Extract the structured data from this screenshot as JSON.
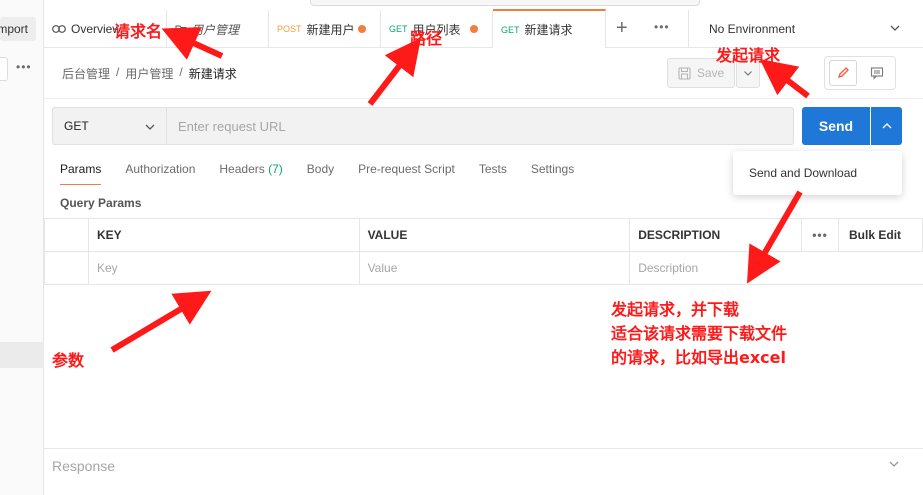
{
  "sidebar": {
    "import_label": "Import",
    "more_icon": "more-dots-icon"
  },
  "tabs": {
    "items": [
      {
        "method": "",
        "label": "Overview",
        "unsaved": false
      },
      {
        "method": "",
        "label": "用户管理",
        "unsaved": false
      },
      {
        "method": "POST",
        "label": "新建用户",
        "unsaved": true
      },
      {
        "method": "GET",
        "label": "用户列表",
        "unsaved": true
      },
      {
        "method": "GET",
        "label": "新建请求",
        "unsaved": false,
        "active": true
      }
    ],
    "add_icon": "plus-icon",
    "more_icon": "more-dots-icon"
  },
  "environment": {
    "selected": "No Environment"
  },
  "breadcrumb": {
    "items": [
      "后台管理",
      "用户管理",
      "新建请求"
    ],
    "separator": "/"
  },
  "toolbar": {
    "save_label": "Save"
  },
  "request": {
    "method": "GET",
    "url_value": "",
    "url_placeholder": "Enter request URL",
    "send_label": "Send",
    "send_menu": [
      "Send and Download"
    ]
  },
  "subtabs": {
    "items": [
      {
        "label": "Params",
        "count": ""
      },
      {
        "label": "Authorization",
        "count": ""
      },
      {
        "label": "Headers",
        "count": "(7)"
      },
      {
        "label": "Body",
        "count": ""
      },
      {
        "label": "Pre-request Script",
        "count": ""
      },
      {
        "label": "Tests",
        "count": ""
      },
      {
        "label": "Settings",
        "count": ""
      }
    ],
    "active": "Params"
  },
  "params": {
    "title": "Query Params",
    "columns": [
      "KEY",
      "VALUE",
      "DESCRIPTION"
    ],
    "bulk_edit_label": "Bulk Edit",
    "placeholders": [
      "Key",
      "Value",
      "Description"
    ]
  },
  "response": {
    "label": "Response"
  },
  "annotations": {
    "request_name": "请求名",
    "path": "路径",
    "send": "发起请求",
    "params": "参数",
    "send_download_line1": "发起请求，并下载",
    "send_download_line2": "适合该请求需要下载文件",
    "send_download_line3": "的请求，比如导出excel"
  },
  "colors": {
    "accent": "#ef7d3c",
    "send_button": "#1f77d8",
    "post_method": "#f0a03c",
    "get_method": "#0ca678",
    "annotation": "#ff1a1a"
  }
}
